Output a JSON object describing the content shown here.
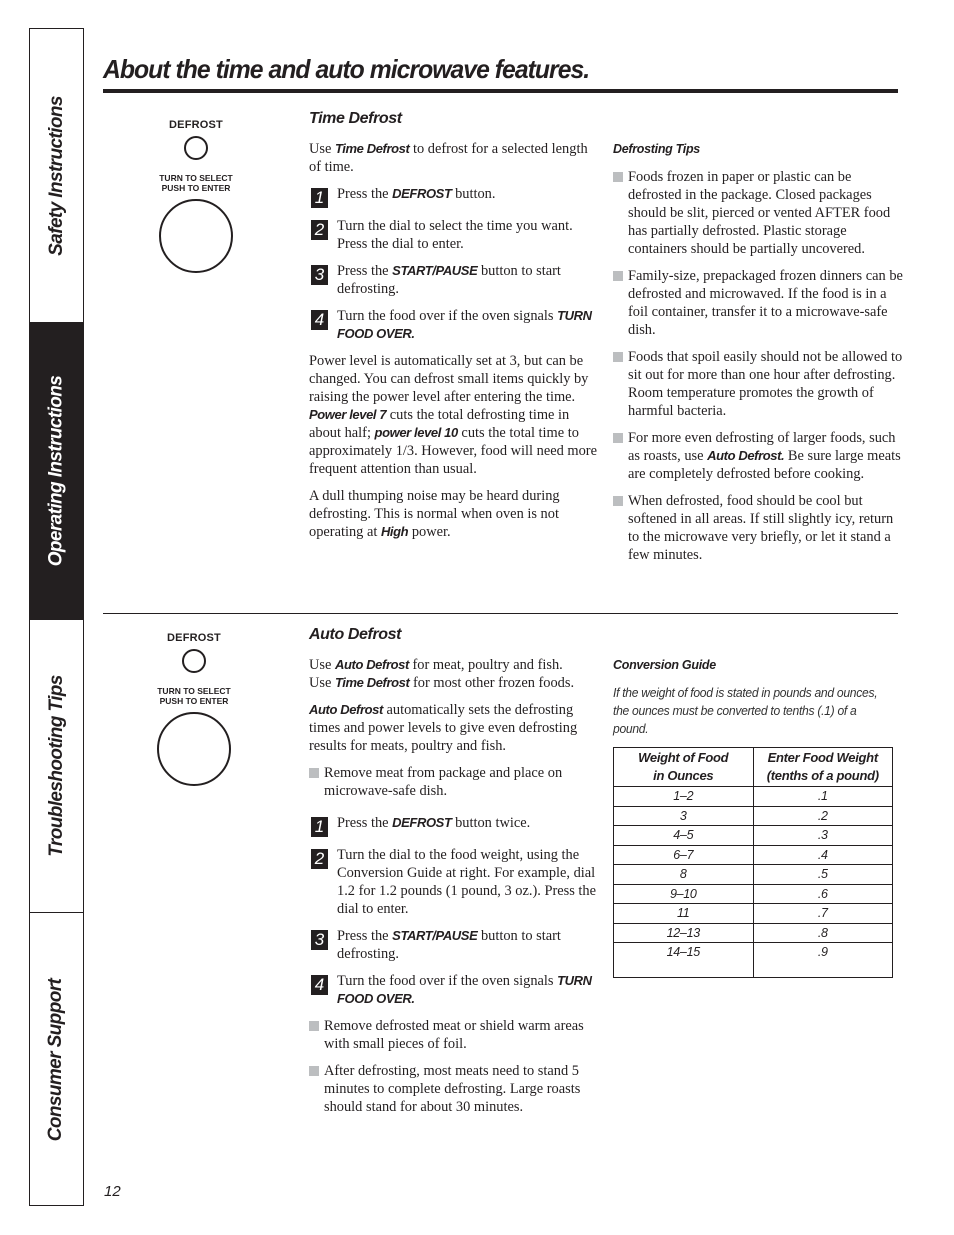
{
  "side_tabs": [
    {
      "label": "Safety Instructions",
      "active": false
    },
    {
      "label": "Operating Instructions",
      "active": true
    },
    {
      "label": "Troubleshooting Tips",
      "active": false
    },
    {
      "label": "Consumer Support",
      "active": false
    }
  ],
  "page_title": "About the time and auto microwave features.",
  "controls": {
    "defrost_label": "DEFROST",
    "dial_label_line1": "Turn to Select",
    "dial_label_line2": "Push to Enter"
  },
  "time_defrost": {
    "heading": "Time Defrost",
    "intro": {
      "pre": "Use ",
      "em": "Time Defrost",
      "post": " to defrost for a selected length of time."
    },
    "steps": [
      {
        "num": "1",
        "pre": "Press the ",
        "em": "DEFROST",
        "post": " button."
      },
      {
        "num": "2",
        "pre": "Turn the dial to select the time you want. Press the dial to enter.",
        "em": "",
        "post": ""
      },
      {
        "num": "3",
        "pre": "Press the ",
        "em": "START/PAUSE",
        "post": " button to start defrosting."
      },
      {
        "num": "4",
        "pre": "Turn the food over if the oven signals ",
        "em": "TURN FOOD OVER.",
        "post": ""
      }
    ],
    "power_para": {
      "p1": "Power level is automatically set at 3, but can be changed. You can defrost small items quickly by raising the power level after entering the time. ",
      "em1": "Power level 7",
      "p2": "  cuts the total defrosting time in about half; ",
      "em2": "power level 10",
      "p3": "  cuts the total time to approximately 1/3. However, food will need more frequent attention than usual."
    },
    "noise_para": {
      "pre": "A dull thumping noise may be heard during defrosting. This is normal when oven is not operating at ",
      "em": "High",
      "post": " power."
    }
  },
  "defrosting_tips": {
    "heading": "Defrosting Tips",
    "items": [
      {
        "pre": "Foods frozen in paper or plastic can be defrosted in the package. Closed packages should be slit, pierced or vented AFTER food has partially defrosted. Plastic storage containers should be partially uncovered.",
        "em": "",
        "post": ""
      },
      {
        "pre": "Family-size, prepackaged frozen dinners can be defrosted and microwaved. If the food is in a foil container, transfer it to a microwave-safe dish.",
        "em": "",
        "post": ""
      },
      {
        "pre": "Foods that spoil easily should not be allowed to sit out for more than one hour after defrosting. Room temperature promotes the growth of harmful bacteria.",
        "em": "",
        "post": ""
      },
      {
        "pre": "For more even defrosting of larger foods, such as roasts, use ",
        "em": "Auto Defrost.",
        "post": " Be sure large meats are completely defrosted before cooking."
      },
      {
        "pre": "When defrosted, food should be cool but softened in all areas. If still slightly icy, return to the microwave very briefly, or let it stand a few minutes.",
        "em": "",
        "post": ""
      }
    ]
  },
  "auto_defrost": {
    "heading": "Auto Defrost",
    "intro": {
      "pre1": "Use ",
      "em1": "Auto Defrost",
      "post1": "  for meat, poultry and fish.",
      "pre2": "Use ",
      "em2": "Time Defrost",
      "post2": " for most other frozen foods."
    },
    "auto_para": {
      "em": "Auto Defrost",
      "post": "  automatically sets the defrosting times and power levels to give even defrosting results for meats, poultry and fish."
    },
    "bullet_before": "Remove meat from package and place on microwave-safe dish.",
    "steps": [
      {
        "num": "1",
        "pre": "Press the ",
        "em": "DEFROST",
        "post": " button twice."
      },
      {
        "num": "2",
        "pre": "Turn the dial to the food weight, using the Conversion Guide at right. For example, dial 1.2 for 1.2 pounds (1 pound, 3 oz.). Press the dial to enter.",
        "em": "",
        "post": ""
      },
      {
        "num": "3",
        "pre": "Press the ",
        "em": "START/PAUSE",
        "post": " button to start defrosting."
      },
      {
        "num": "4",
        "pre": "Turn the food over if the oven signals ",
        "em": "TURN FOOD OVER.",
        "post": ""
      }
    ],
    "bullets_after": [
      "Remove defrosted meat or shield warm areas with small pieces of foil.",
      "After defrosting, most meats need to stand 5 minutes to complete defrosting. Large roasts should stand for about 30 minutes."
    ]
  },
  "conversion_guide": {
    "heading": "Conversion Guide",
    "note": "If the weight of food is stated in pounds and ounces, the ounces must be converted to tenths (.1) of a pound.",
    "columns": [
      {
        "line1": "Weight of Food",
        "line2": "in Ounces"
      },
      {
        "line1": "Enter Food Weight",
        "line2": "(tenths of a pound)"
      }
    ],
    "rows": [
      [
        "1–2",
        ".1"
      ],
      [
        "3",
        ".2"
      ],
      [
        "4–5",
        ".3"
      ],
      [
        "6–7",
        ".4"
      ],
      [
        "8",
        ".5"
      ],
      [
        "9–10",
        ".6"
      ],
      [
        "11",
        ".7"
      ],
      [
        "12–13",
        ".8"
      ],
      [
        "14–15",
        ".9"
      ]
    ]
  },
  "page_number": "12"
}
